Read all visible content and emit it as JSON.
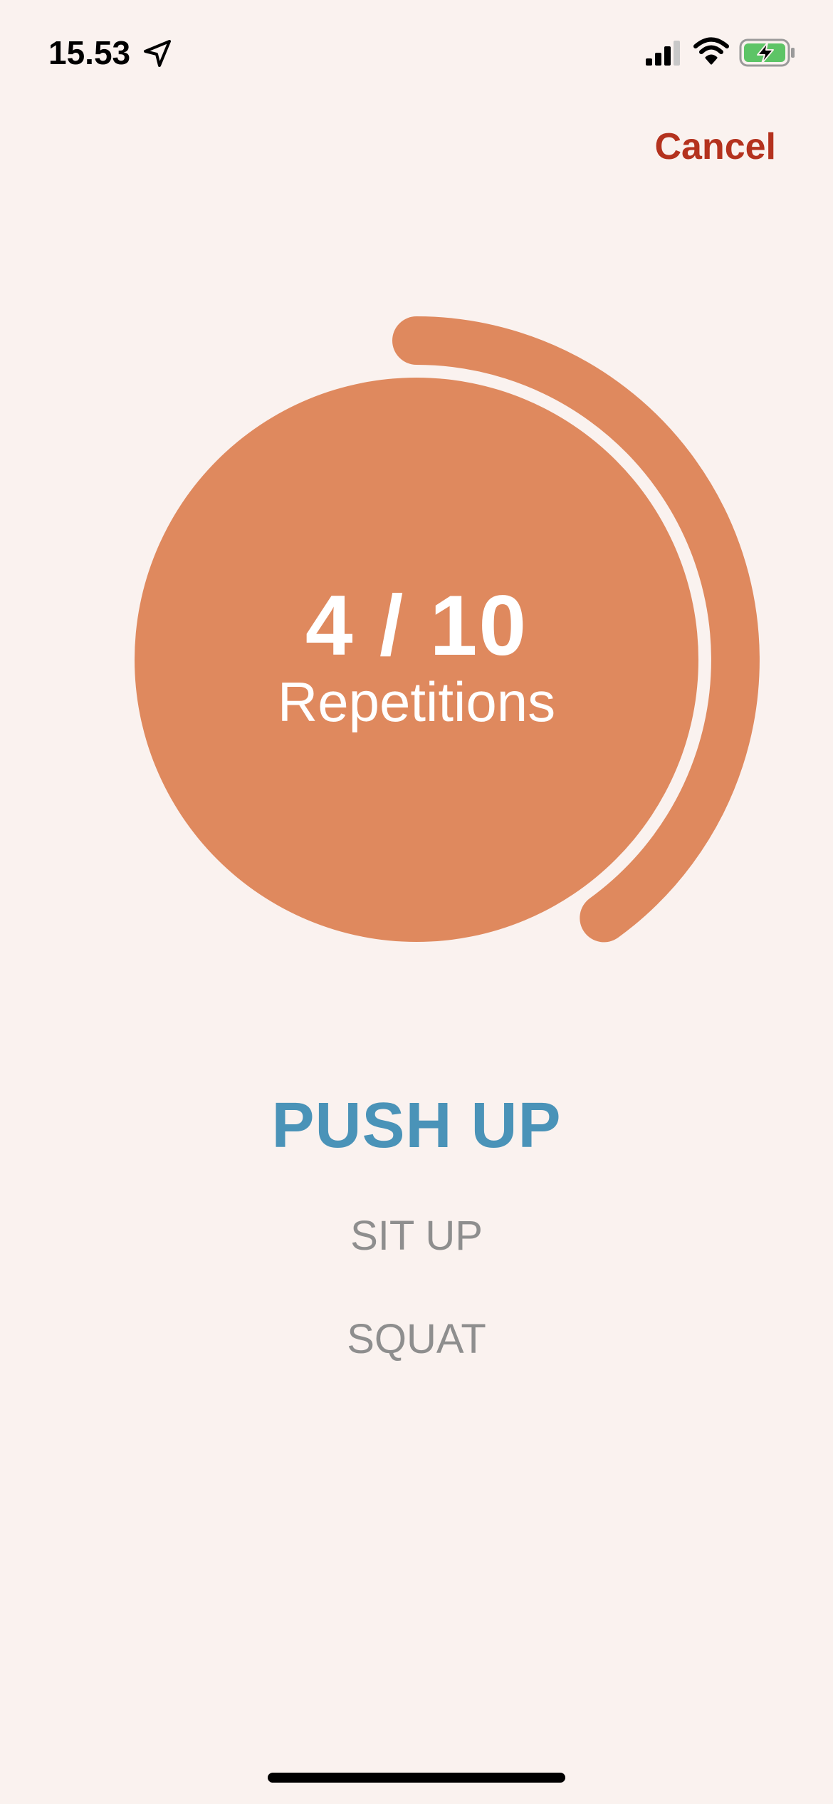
{
  "status_bar": {
    "time": "15.53",
    "icons": [
      "location-arrow-icon",
      "cellular-signal-icon",
      "wifi-icon",
      "battery-charging-icon"
    ]
  },
  "nav": {
    "cancel_label": "Cancel"
  },
  "counter": {
    "value": "4 / 10",
    "label": "Repetitions",
    "completed": 4,
    "total": 10,
    "progress_fraction": 0.4
  },
  "exercise_picker": {
    "selected": "PUSH UP",
    "options": [
      "SIT UP",
      "SQUAT"
    ]
  },
  "colors": {
    "background": "#FAF2EF",
    "ring_orange": "#DF895E",
    "cancel_red": "#B4321E",
    "selected_blue": "#4A93B8",
    "option_gray": "#8E8E8E",
    "battery_green": "#5DC466"
  }
}
